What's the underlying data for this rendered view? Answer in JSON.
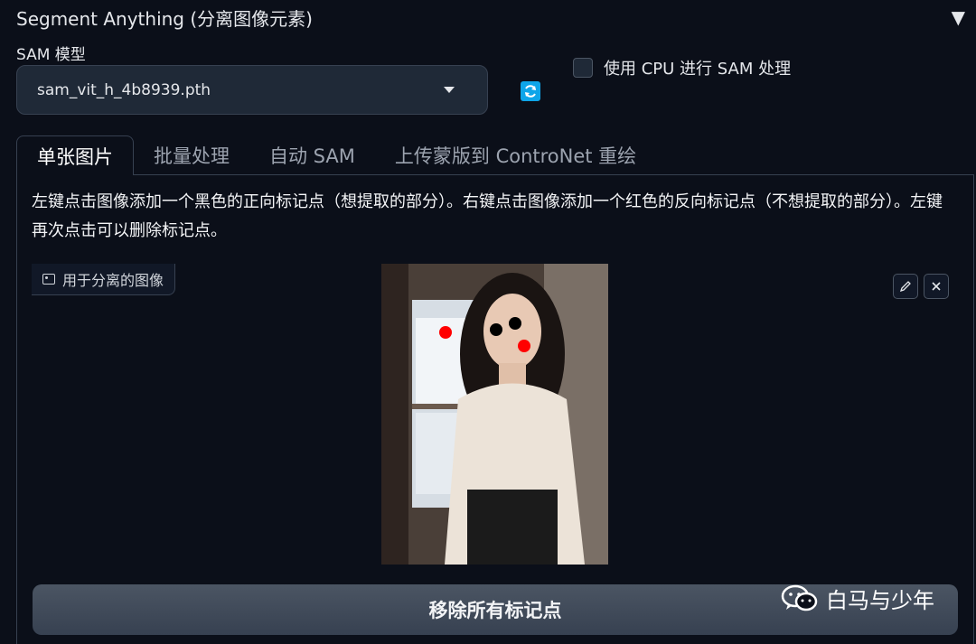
{
  "accordion": {
    "title": "Segment Anything (分离图像元素)",
    "toggle": "▼"
  },
  "model": {
    "label": "SAM 模型",
    "selected": "sam_vit_h_4b8939.pth"
  },
  "cpu_option": {
    "label": "使用 CPU 进行 SAM 处理",
    "checked": false
  },
  "tabs": [
    {
      "label": "单张图片",
      "active": true
    },
    {
      "label": "批量处理",
      "active": false
    },
    {
      "label": "自动 SAM",
      "active": false
    },
    {
      "label": "上传蒙版到 ControNet 重绘",
      "active": false
    }
  ],
  "instructions": "左键点击图像添加一个黑色的正向标记点（想提取的部分）。右键点击图像添加一个红色的反向标记点（不想提取的部分）。左键再次点击可以删除标记点。",
  "image_panel": {
    "label": "用于分离的图像"
  },
  "remove_button": {
    "label": "移除所有标记点"
  },
  "watermark": {
    "text": "白马与少年"
  },
  "colors": {
    "accent": "#0ea5e9",
    "background": "#0b0f19",
    "positive_marker": "#000000",
    "negative_marker": "#ff0000"
  }
}
